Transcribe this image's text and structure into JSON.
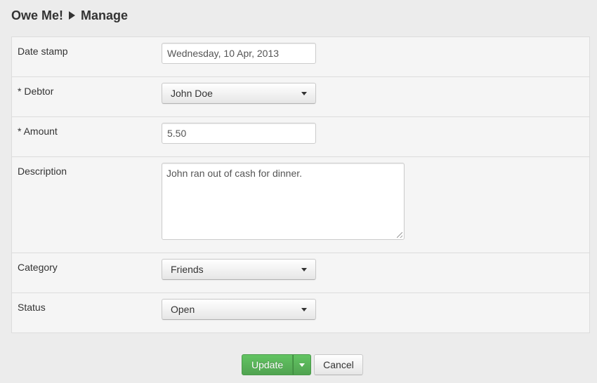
{
  "header": {
    "app_name": "Owe Me!",
    "page": "Manage"
  },
  "form": {
    "date_stamp": {
      "label": "Date stamp",
      "value": "Wednesday, 10 Apr, 2013"
    },
    "debtor": {
      "label": "* Debtor",
      "value": "John Doe"
    },
    "amount": {
      "label": "* Amount",
      "value": "5.50"
    },
    "description": {
      "label": "Description",
      "value": "John ran out of cash for dinner."
    },
    "category": {
      "label": "Category",
      "value": "Friends"
    },
    "status": {
      "label": "Status",
      "value": "Open"
    }
  },
  "actions": {
    "update_label": "Update",
    "cancel_label": "Cancel"
  },
  "colors": {
    "update_button": "#5bb75b",
    "background": "#ececec",
    "form_background": "#f5f5f5"
  },
  "icons": [
    "breadcrumb-arrow-icon",
    "chevron-down-icon",
    "resize-grip-icon"
  ]
}
